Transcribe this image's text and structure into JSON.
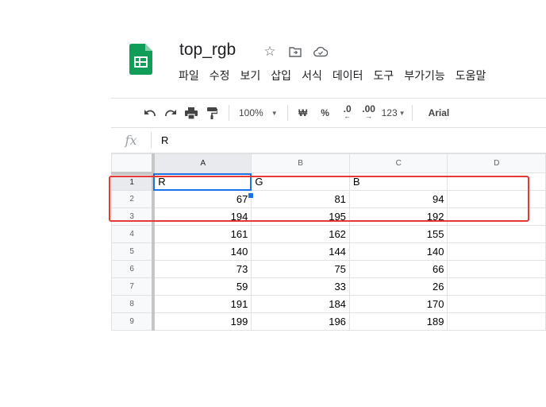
{
  "doc": {
    "title": "top_rgb",
    "menus": [
      "파일",
      "수정",
      "보기",
      "삽입",
      "서식",
      "데이터",
      "도구",
      "부가기능",
      "도움말"
    ]
  },
  "toolbar": {
    "zoom": "100%",
    "currency": "₩",
    "percent": "%",
    "dec_decrease": ".0",
    "dec_increase": ".00",
    "format_more": "123",
    "font": "Arial"
  },
  "formula_bar": {
    "fx_label": "fx",
    "value": "R"
  },
  "sheet": {
    "columns": [
      "A",
      "B",
      "C",
      "D"
    ],
    "selected_column": "A",
    "active_cell": "A1",
    "rows": [
      {
        "num": "1",
        "cells": [
          "R",
          "G",
          "B",
          ""
        ]
      },
      {
        "num": "2",
        "cells": [
          "67",
          "81",
          "94",
          ""
        ]
      },
      {
        "num": "3",
        "cells": [
          "194",
          "195",
          "192",
          ""
        ]
      },
      {
        "num": "4",
        "cells": [
          "161",
          "162",
          "155",
          ""
        ]
      },
      {
        "num": "5",
        "cells": [
          "140",
          "144",
          "140",
          ""
        ]
      },
      {
        "num": "6",
        "cells": [
          "73",
          "75",
          "66",
          ""
        ]
      },
      {
        "num": "7",
        "cells": [
          "59",
          "33",
          "26",
          ""
        ]
      },
      {
        "num": "8",
        "cells": [
          "191",
          "184",
          "170",
          ""
        ]
      },
      {
        "num": "9",
        "cells": [
          "199",
          "196",
          "189",
          ""
        ]
      }
    ]
  },
  "colors": {
    "brand_green": "#0f9d58",
    "selection_blue": "#1a73e8",
    "annotation_red": "#e53935"
  }
}
